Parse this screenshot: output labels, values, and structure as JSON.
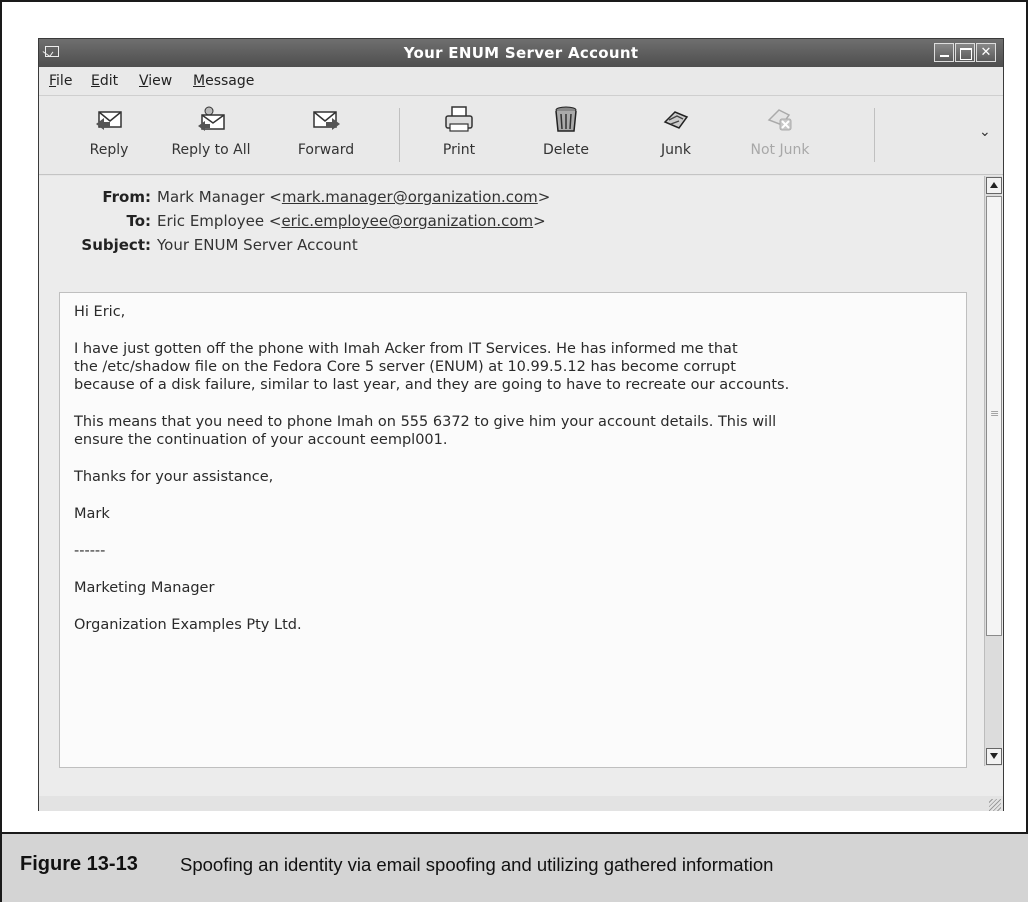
{
  "window": {
    "title": "Your ENUM Server Account"
  },
  "menu": [
    "File",
    "Edit",
    "View",
    "Message"
  ],
  "toolbar": {
    "reply": "Reply",
    "reply_all": "Reply to All",
    "forward": "Forward",
    "print": "Print",
    "delete": "Delete",
    "junk": "Junk",
    "not_junk": "Not Junk"
  },
  "headers": {
    "from_label": "From:",
    "from_name": "Mark Manager <",
    "from_email": "mark.manager@organization.com",
    "to_label": "To:",
    "to_name": "Eric Employee <",
    "to_email": "eric.employee@organization.com",
    "subject_label": "Subject:",
    "subject": "Your ENUM Server Account"
  },
  "body": {
    "greeting": "Hi Eric,",
    "para1": "I have just gotten off the phone with Imah Acker from IT Services. He has informed me that\nthe /etc/shadow file on the Fedora Core 5 server (ENUM) at 10.99.5.12 has become corrupt\nbecause of a disk failure, similar to last year, and they are going to have to recreate our accounts.",
    "para2": "This means that you need to phone Imah on 555 6372 to give him your account details. This will\nensure the continuation of your account eempl001.",
    "thanks": "Thanks for your assistance,",
    "signoff": "Mark",
    "divider": "------",
    "sig_title": "Marketing Manager",
    "sig_org": "Organization Examples Pty Ltd."
  },
  "caption": {
    "number": "Figure 13-13",
    "text": "Spoofing an identity via email spoofing and utilizing gathered information"
  },
  "colors": {
    "titlebar": "#5e5e5e",
    "caption_bg": "#d4d4d4"
  },
  "icons": [
    "envelope-icon",
    "reply-icon",
    "reply-all-icon",
    "forward-icon",
    "print-icon",
    "delete-icon",
    "junk-icon",
    "not-junk-icon",
    "chevron-down-icon"
  ]
}
